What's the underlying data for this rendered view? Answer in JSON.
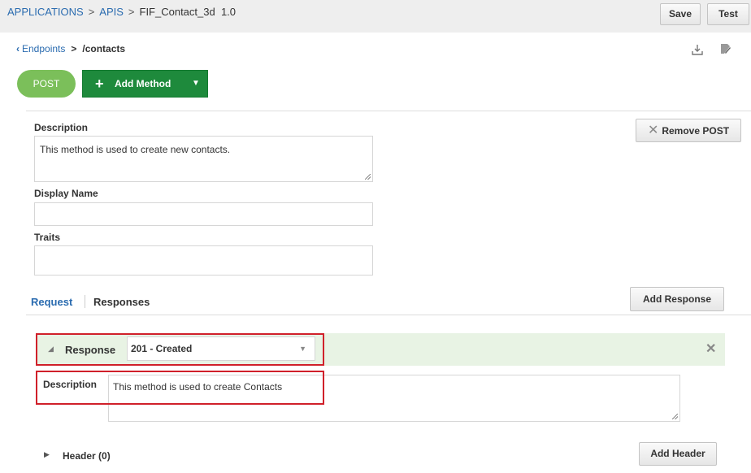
{
  "breadcrumb": {
    "items": [
      "APPLICATIONS",
      "APIS",
      "FIF_Contact_3d  1.0"
    ],
    "separator": ">"
  },
  "toolbar": {
    "save_label": "Save",
    "test_label": "Test"
  },
  "endpoint": {
    "back_label": "Endpoints",
    "separator": ">",
    "path": "/contacts",
    "icons": [
      "download-icon",
      "edit-icon"
    ]
  },
  "method": {
    "active": "POST",
    "add_label": "Add Method",
    "remove_label": "Remove POST"
  },
  "form": {
    "description_label": "Description",
    "description_value": "This method is used to create new contacts.",
    "display_name_label": "Display Name",
    "display_name_value": "",
    "traits_label": "Traits",
    "traits_value": ""
  },
  "tabs": {
    "request_label": "Request",
    "responses_label": "Responses",
    "active": "Request",
    "add_response_label": "Add Response"
  },
  "response": {
    "label": "Response",
    "selected": "201 - Created",
    "description_label": "Description",
    "description_value": "This method is used to create Contacts"
  },
  "header": {
    "label": "Header (0)",
    "add_label": "Add Header"
  },
  "colors": {
    "post_pill": "#7bbf5a",
    "add_method": "#1e8a3c",
    "link": "#2b6cb0",
    "highlight_box": "#d0202a",
    "response_header_bg": "#e8f3e4"
  }
}
